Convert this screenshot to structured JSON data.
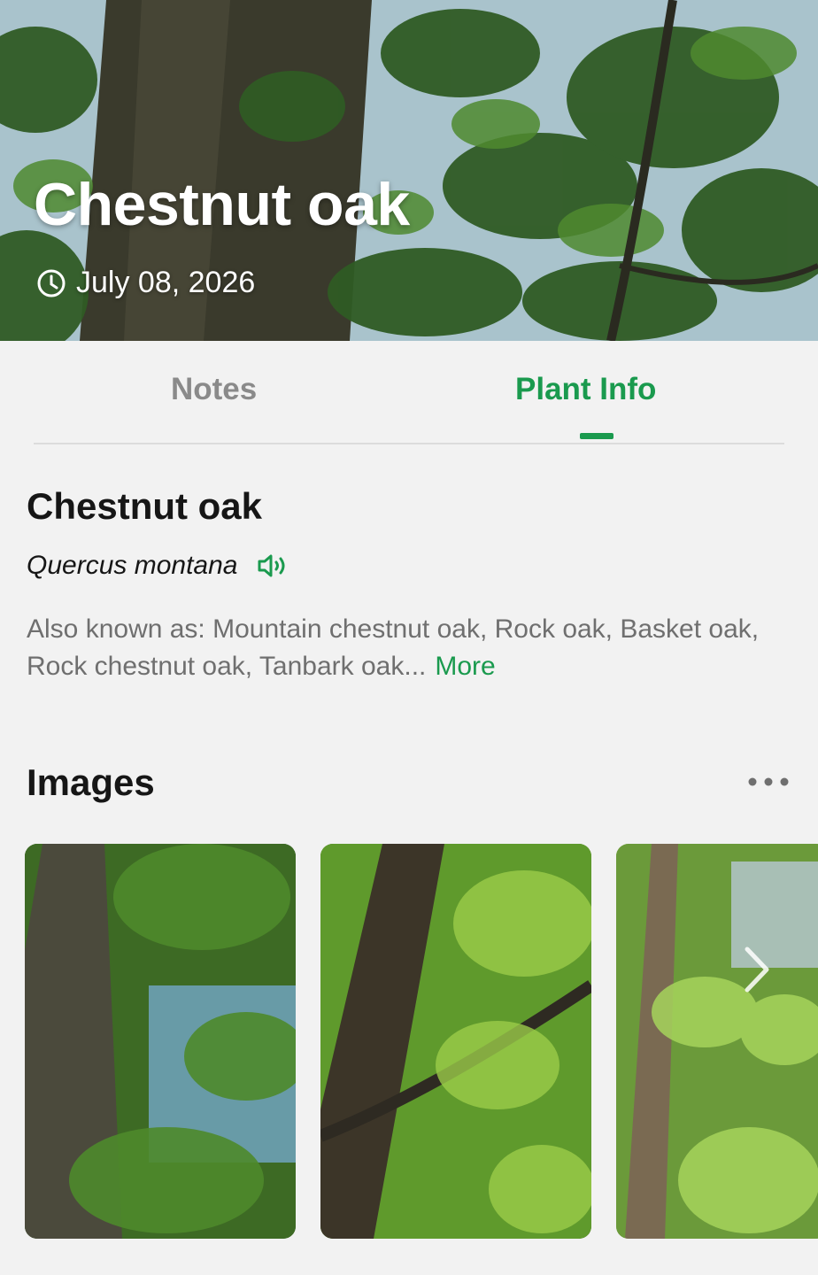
{
  "header": {
    "title": "Chestnut oak",
    "date": "July 08, 2026",
    "date_icon": "clock-icon"
  },
  "tabs": [
    {
      "label": "Notes",
      "active": false
    },
    {
      "label": "Plant Info",
      "active": true
    }
  ],
  "plant_info": {
    "common_name": "Chestnut oak",
    "scientific_name": "Quercus montana",
    "audio_icon": "speaker-icon",
    "also_known_as": "Also known as: Mountain chestnut oak, Rock oak, Basket oak, Rock chestnut oak, Tanbark oak...",
    "more_label": "More"
  },
  "images_section": {
    "title": "Images",
    "menu_icon": "more-icon",
    "next_icon": "chevron-right-icon"
  },
  "colors": {
    "accent": "#1a9a4e",
    "inactive_tab": "#8a8a8a",
    "background": "#f2f2f2",
    "body_text": "#161616",
    "secondary_text": "#6f6f6f"
  }
}
